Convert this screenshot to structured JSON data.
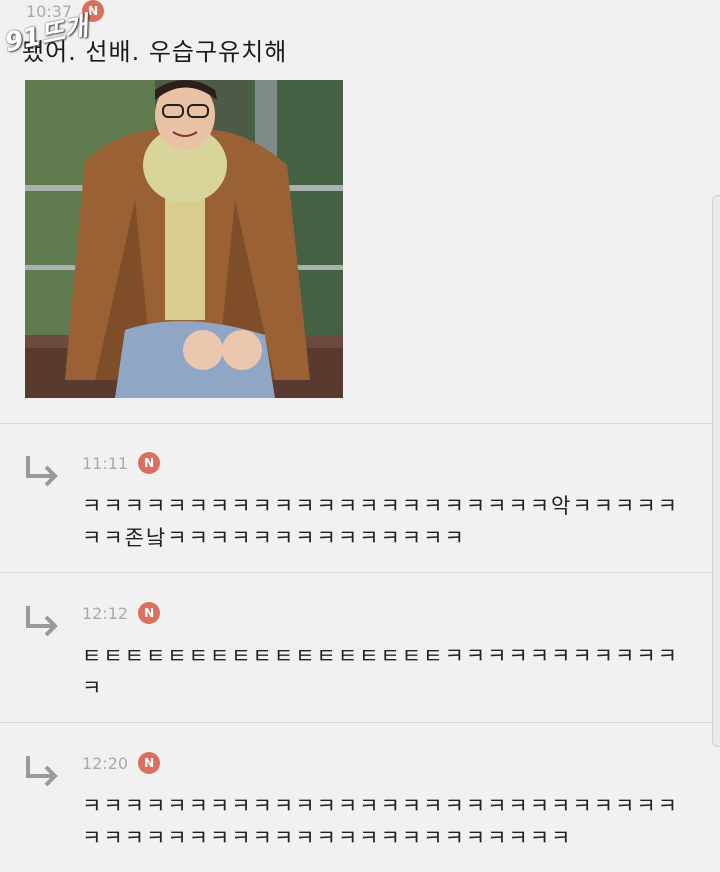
{
  "watermark": {
    "text": "91뜨개"
  },
  "post": {
    "time": "10:37",
    "badge": "N",
    "title": "됐어. 선배. 우습구유치해"
  },
  "replies": [
    {
      "time": "11:11",
      "badge": "N",
      "text": "ㅋㅋㅋㅋㅋㅋㅋㅋㅋㅋㅋㅋㅋㅋㅋㅋㅋㅋㅋㅋㅋㅋ악ㅋㅋㅋㅋㅋㅋㅋ존낰ㅋㅋㅋㅋㅋㅋㅋㅋㅋㅋㅋㅋㅋㅋ"
    },
    {
      "time": "12:12",
      "badge": "N",
      "text": "ㅌㅌㅌㅌㅌㅌㅌㅌㅌㅌㅌㅌㅌㅌㅌㅌㅌㅋㅋㅋㅋㅋㅋㅋㅋㅋㅋㅋㅋ"
    },
    {
      "time": "12:20",
      "badge": "N",
      "text": "ㅋㅋㅋㅋㅋㅋㅋㅋㅋㅋㅋㅋㅋㅋㅋㅋㅋㅋㅋㅋㅋㅋㅋㅋㅋㅋㅋㅋㅋㅋㅋㅋㅋㅋㅋㅋㅋㅋㅋㅋㅋㅋㅋㅋㅋㅋㅋㅋㅋㅋㅋ"
    }
  ],
  "icons": {
    "reply": "reply-arrow-icon",
    "badge": "new-badge-icon"
  },
  "colors": {
    "badge": "#d9705f",
    "background": "#f1f1f1",
    "divider": "#d6d6d6"
  }
}
